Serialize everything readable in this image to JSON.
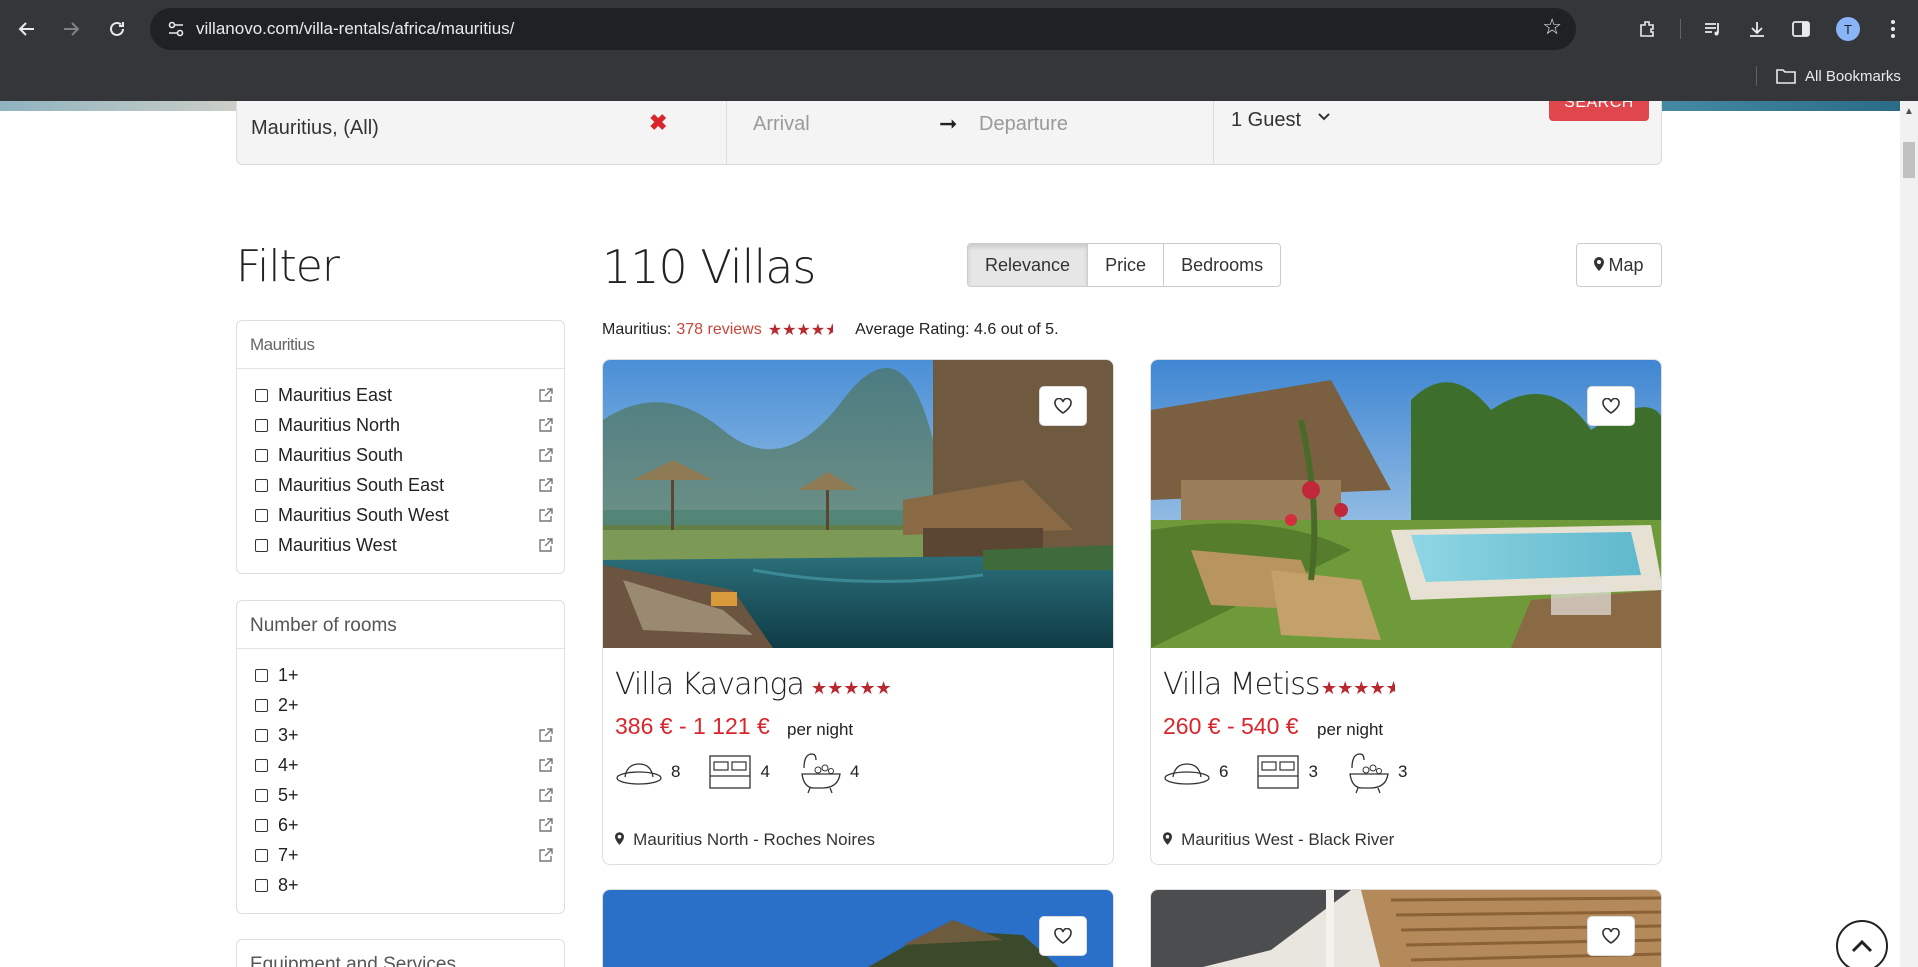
{
  "browser": {
    "url": "villanovo.com/villa-rentals/africa/mauritius/",
    "avatar_letter": "T",
    "bookmarks_folder": "All Bookmarks"
  },
  "search": {
    "destination": "Mauritius, (All)",
    "arrival_placeholder": "Arrival",
    "departure_placeholder": "Departure",
    "guests": "1 Guest",
    "search_label": "SEARCH"
  },
  "filter": {
    "title": "Filter",
    "regions_header": "Mauritius",
    "regions": [
      "Mauritius East",
      "Mauritius North",
      "Mauritius South",
      "Mauritius South East",
      "Mauritius South West",
      "Mauritius West"
    ],
    "rooms_header": "Number of rooms",
    "rooms": [
      "1+",
      "2+",
      "3+",
      "4+",
      "5+",
      "6+",
      "7+",
      "8+"
    ],
    "equipment_header": "Equipment and Services"
  },
  "results": {
    "count_title": "110 Villas",
    "sort": [
      "Relevance",
      "Price",
      "Bedrooms"
    ],
    "active_sort": "Relevance",
    "map_label": "Map",
    "rating_prefix": "Mauritius:",
    "reviews_link": "378 reviews",
    "average_text": "Average Rating: 4.6 out of 5."
  },
  "villas": [
    {
      "name": "Villa Kavanga",
      "price": "386 € - 1 121 €",
      "per_night": "per night",
      "guests": "8",
      "bedrooms": "4",
      "bathrooms": "4",
      "location": "Mauritius North - Roches Noires",
      "rating": 5
    },
    {
      "name": "Villa Metiss",
      "price": "260 € - 540 €",
      "per_night": "per night",
      "guests": "6",
      "bedrooms": "3",
      "bathrooms": "3",
      "location": "Mauritius West - Black River",
      "rating": 4.5
    }
  ],
  "colors": {
    "accent_red": "#d9262c",
    "star_red": "#b8292f",
    "search_button": "#e0474c"
  }
}
